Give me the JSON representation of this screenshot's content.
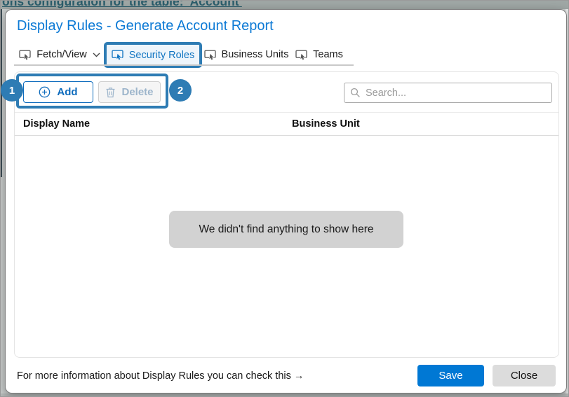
{
  "background": {
    "clipped_text": "ons configuration for the table: 'Account'"
  },
  "dialog": {
    "title": "Display Rules - Generate Account Report",
    "tabs": [
      {
        "label": "Fetch/View",
        "selected": false,
        "has_dropdown": true
      },
      {
        "label": "Security Roles",
        "selected": true,
        "annotated": true
      },
      {
        "label": "Business Units",
        "selected": false
      },
      {
        "label": "Teams",
        "selected": false
      }
    ],
    "toolbar": {
      "add_label": "Add",
      "delete_label": "Delete",
      "delete_disabled": true
    },
    "annotations": {
      "badge_1": "1",
      "badge_2": "2"
    },
    "search": {
      "placeholder": "Search..."
    },
    "table": {
      "columns": [
        "Display Name",
        "Business Unit"
      ],
      "rows": [],
      "empty_message": "We didn't find anything to show here"
    },
    "footer": {
      "info_text": "For more information about Display Rules you can check this →",
      "save_label": "Save",
      "close_label": "Close"
    }
  },
  "colors": {
    "title_blue": "#0d7ad5",
    "accent_blue": "#0078d4",
    "annotation_blue": "#2e7cb4",
    "selected_tab_blue": "#1175c2",
    "add_button_blue": "#0f6cbd",
    "disabled_text": "#9db5cb",
    "empty_state_bg": "#d2d2d2"
  }
}
